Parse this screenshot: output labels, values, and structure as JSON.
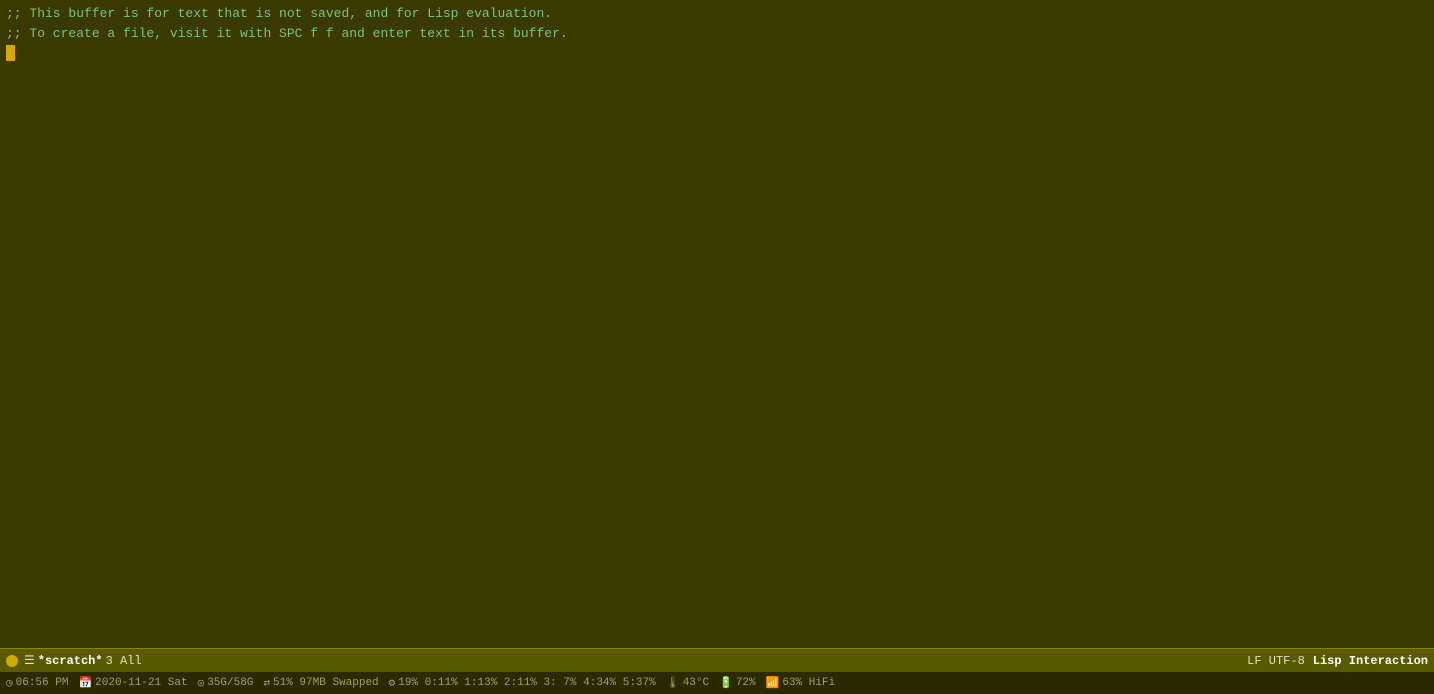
{
  "editor": {
    "background_color": "#3a3a00",
    "text_color": "#7fbf7f",
    "comment_line1": ";; This buffer is for text that is not saved, and for Lisp evaluation.",
    "comment_line2": ";; To create a file, visit it with SPC f f and enter text in its buffer."
  },
  "modeline": {
    "circle_color": "#d4a800",
    "icon_buffer": "☰",
    "buffer_name": "*scratch*",
    "line_info": "3 All",
    "encoding": "LF UTF-8",
    "mode": "Lisp Interaction"
  },
  "statusbar": {
    "time_icon": "◷",
    "time": "06:56 PM",
    "date_icon": "🗓",
    "date": "2020-11-21 Sat",
    "disk_icon": "◎",
    "disk": "35G/58G",
    "swap_icon": "⇄",
    "swap": "51% 97MB Swapped",
    "cpu_icon": "⚙",
    "cpu": "19% 0:11% 1:13% 2:11% 3: 7% 4:34% 5:37%",
    "temp_icon": "🌡",
    "temp": "43°C",
    "battery_icon": "🔋",
    "battery": "72%",
    "wifi_icon": "📶",
    "wifi": "63% HiFi"
  }
}
